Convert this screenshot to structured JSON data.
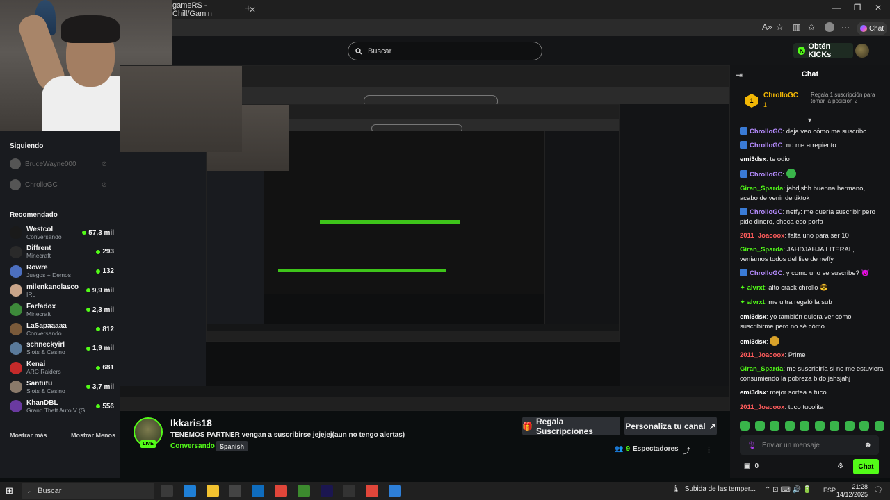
{
  "browser": {
    "tab_title": "gameRS - Chill/Gamin",
    "tab_close": "✕",
    "new_tab": "+",
    "window_controls": [
      "—",
      "❐",
      "✕"
    ],
    "chat_button": "Chat",
    "toolbar_icons": [
      "reader-mode-icon",
      "favorite-icon",
      "split-screen-icon",
      "favorites-bar-icon",
      "profile-icon",
      "more-icon"
    ]
  },
  "kick": {
    "search_placeholder": "Buscar",
    "get_kicks": "Obtén KICKs"
  },
  "sidebar": {
    "following_header": "Siguiendo",
    "following": [
      {
        "name": "BruceWayne000"
      },
      {
        "name": "ChrolloGC"
      }
    ],
    "recommended_header": "Recomendado",
    "recommended": [
      {
        "name": "Westcol",
        "category": "Conversando",
        "viewers": "57,3 mil",
        "color": "#1a1a1a"
      },
      {
        "name": "Diffrent",
        "category": "Minecraft",
        "viewers": "293",
        "color": "#2a2a2a"
      },
      {
        "name": "Rowre",
        "category": "Juegos + Demos",
        "viewers": "132",
        "color": "#4c6fbf"
      },
      {
        "name": "milenkanolasco",
        "category": "IRL",
        "viewers": "9,9 mil",
        "color": "#c9a58a"
      },
      {
        "name": "Farfadox",
        "category": "Minecraft",
        "viewers": "2,3 mil",
        "color": "#3d8a3a"
      },
      {
        "name": "LaSapaaaaa",
        "category": "Conversando",
        "viewers": "812",
        "color": "#7a5a3a"
      },
      {
        "name": "schneckyirl",
        "category": "Slots & Casino",
        "viewers": "1,9 mil",
        "color": "#5a7a9a"
      },
      {
        "name": "Kenai",
        "category": "ARC Raiders",
        "viewers": "681",
        "color": "#c42a2a"
      },
      {
        "name": "Santutu",
        "category": "Slots & Casino",
        "viewers": "3,7 mil",
        "color": "#8a7a6a"
      },
      {
        "name": "KhanDBL",
        "category": "Grand Theft Auto V (G...",
        "viewers": "556",
        "color": "#6a3aa0"
      }
    ],
    "show_more": "Mostrar más",
    "show_less": "Mostrar Menos"
  },
  "stream": {
    "streamer": "Ikkaris18",
    "live": "LIVE",
    "title": "TENEMOS PARTNER vengan a suscribirse jejejej(aun no tengo alertas)",
    "category": "Conversando",
    "language": "Spanish",
    "gift_subs": "Regala Suscripciones",
    "customize": "Personaliza tu canal",
    "viewers_count": "9",
    "viewers_label": "Espectadores"
  },
  "chat": {
    "title": "Chat",
    "pinned": {
      "badge": "1",
      "name": "ChrolloGC",
      "count": "1",
      "text": "Regala 1 suscripción para tomar la posición 2"
    },
    "messages": [
      {
        "user": "ChrolloGC",
        "color": "#b68cff",
        "icon": true,
        "text": "deja veo cómo me suscribo",
        "emote": null
      },
      {
        "user": "ChrolloGC",
        "color": "#b68cff",
        "icon": true,
        "text": "no me arrepiento",
        "emote": null
      },
      {
        "user": "emi3dsx",
        "color": "#ffffff",
        "icon": false,
        "text": "te odio",
        "emote": null
      },
      {
        "user": "ChrolloGC",
        "color": "#b68cff",
        "icon": true,
        "text": "",
        "emote": "#39b54a"
      },
      {
        "user": "Giran_Sparda",
        "color": "#53fc18",
        "icon": false,
        "text": "jahdjshh buenna hermano, acabo de venir de tiktok",
        "emote": null
      },
      {
        "user": "ChrolloGC",
        "color": "#b68cff",
        "icon": true,
        "text": "neffy: me quería suscribir pero pide dinero, checa eso porfa",
        "emote": null
      },
      {
        "user": "2011_Joacoox",
        "color": "#ff5c5c",
        "icon": false,
        "text": "falta uno para ser 10",
        "emote": null
      },
      {
        "user": "Giran_Sparda",
        "color": "#53fc18",
        "icon": false,
        "text": "JAHDJAHJA LITERAL, veniamos todos del live de neffy",
        "emote": null
      },
      {
        "user": "ChrolloGC",
        "color": "#b68cff",
        "icon": true,
        "text": "y como uno se suscribe? 👿",
        "emote": null
      },
      {
        "user": "alvrxt",
        "color": "#53fc18",
        "icon": false,
        "text": "alto crack chrollo 😎",
        "emote": null
      },
      {
        "user": "alvrxt",
        "color": "#53fc18",
        "icon": false,
        "text": "me ultra regaló la sub",
        "emote": null
      },
      {
        "user": "emi3dsx",
        "color": "#ffffff",
        "icon": false,
        "text": "yo también quiera ver cómo suscribirme pero no sé cómo",
        "emote": null
      },
      {
        "user": "emi3dsx",
        "color": "#ffffff",
        "icon": false,
        "text": "",
        "emote": "#d9a22a"
      },
      {
        "user": "2011_Joacoox",
        "color": "#ff5c5c",
        "icon": false,
        "text": "Prime",
        "emote": null
      },
      {
        "user": "Giran_Sparda",
        "color": "#53fc18",
        "icon": false,
        "text": "me suscribiría si no me estuviera consumiendo la pobreza bido jahsjahj",
        "emote": null
      },
      {
        "user": "emi3dsx",
        "color": "#ffffff",
        "icon": false,
        "text": "mejor sortea a tuco",
        "emote": null
      },
      {
        "user": "2011_Joacoox",
        "color": "#ff5c5c",
        "icon": false,
        "text": "tuco tucolita",
        "emote": null
      }
    ],
    "input_placeholder": "Enviar un mensaje",
    "points": "0",
    "send": "Chat"
  },
  "taskbar": {
    "search_placeholder": "Buscar",
    "weather": "Subida de las temper...",
    "lang": "ESP",
    "time": "21:28",
    "date": "14/12/2025",
    "apps": [
      {
        "name": "task-view",
        "color": "#3a3a3a"
      },
      {
        "name": "edge",
        "color": "#1f7fd6"
      },
      {
        "name": "file-explorer",
        "color": "#f2c230"
      },
      {
        "name": "calculator",
        "color": "#444"
      },
      {
        "name": "outlook",
        "color": "#0f6cbd"
      },
      {
        "name": "chrome",
        "color": "#e0463a"
      },
      {
        "name": "minecraft",
        "color": "#3c8a2e"
      },
      {
        "name": "animate",
        "color": "#1b1650"
      },
      {
        "name": "obs",
        "color": "#333"
      },
      {
        "name": "chrome-2",
        "color": "#e0463a"
      },
      {
        "name": "app",
        "color": "#2e7fd8"
      }
    ]
  }
}
